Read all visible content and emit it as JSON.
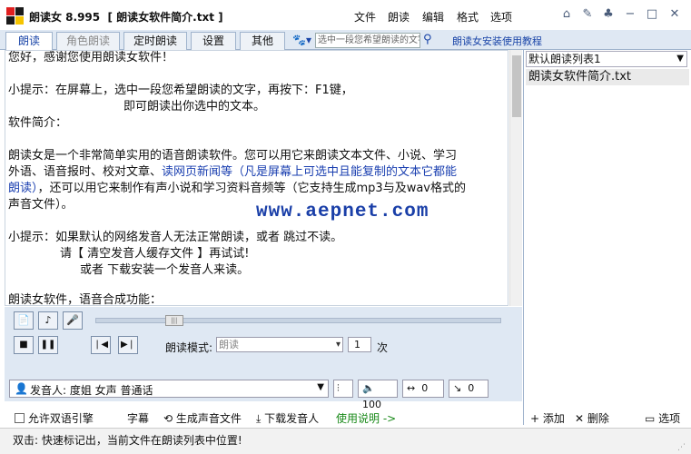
{
  "window": {
    "title": "朗读女 8.995  [ 朗读女软件简介.txt ]",
    "menu": [
      "文件",
      "朗读",
      "编辑",
      "格式",
      "选项"
    ]
  },
  "colors": {
    "accent": "#1a45a8",
    "tab_bg": "#dfe8f3",
    "watermark": "#1a3fa8"
  },
  "tabs": [
    {
      "label": "朗读",
      "active": true
    },
    {
      "label": "角色朗读",
      "active": false,
      "dimmed": true
    },
    {
      "label": "定时朗读",
      "active": false
    },
    {
      "label": "设置",
      "active": false
    },
    {
      "label": "其他",
      "active": false
    }
  ],
  "search": {
    "placeholder": "选中一段您希望朗读的文字"
  },
  "help_link": "朗读女安装使用教程",
  "document": {
    "lines": [
      {
        "text": "您好，感谢您使用朗读女软件！"
      },
      {
        "text": "小提示：在屏幕上，选中一段您希望朗读的文字，再按下：F1键，"
      },
      {
        "text": "即可朗读出你选中的文本。"
      },
      {
        "text": "软件简介："
      },
      {
        "text": "朗读女是一个非常简单实用的语音朗读软件。您可以用它来朗读文本文件、小说、学习"
      },
      {
        "text_a": "外语、语音报时、校对文章、",
        "text_b": "读网页新闻等（凡是屏幕上可选中且能复制的文本它都能"
      },
      {
        "text_a": "朗读）",
        "text_b": "，还可以用它来制作有声小说和学习资料音频等（它支持生成mp3与及wav格式的"
      },
      {
        "text": "声音文件）。"
      },
      {
        "text": "小提示：如果默认的网络发音人无法正常朗读，或者 跳过不读。"
      },
      {
        "text": "请【 清空发音人缓存文件 】再试试!"
      },
      {
        "text": "或者 下载安装一个发音人来读。"
      },
      {
        "text": "朗读女软件，语音合成功能："
      }
    ],
    "watermark": "www.aepnet.com"
  },
  "playlist": {
    "selected_list": "默认朗读列表1",
    "items": [
      "朗读女软件简介.txt"
    ]
  },
  "playback": {
    "mode_label": "朗读模式:",
    "mode_value": "朗读",
    "repeat_count": "1",
    "repeat_unit": "次",
    "seek_position": 0.18
  },
  "voice": {
    "label": "发音人: 度姐 女声 普通话",
    "volume": "100",
    "speed": "0",
    "pitch": "0"
  },
  "bottom": {
    "dual_lang_checkbox": "允许双语引擎",
    "subtitle": "字幕",
    "generate_audio": "生成声音文件",
    "download_voice": "下载发音人",
    "usage_link": "使用说明 ->",
    "add": "添加",
    "delete": "删除",
    "options": "选项"
  },
  "status": {
    "text": "双击: 快速标记出，当前文件在朗读列表中位置!"
  }
}
